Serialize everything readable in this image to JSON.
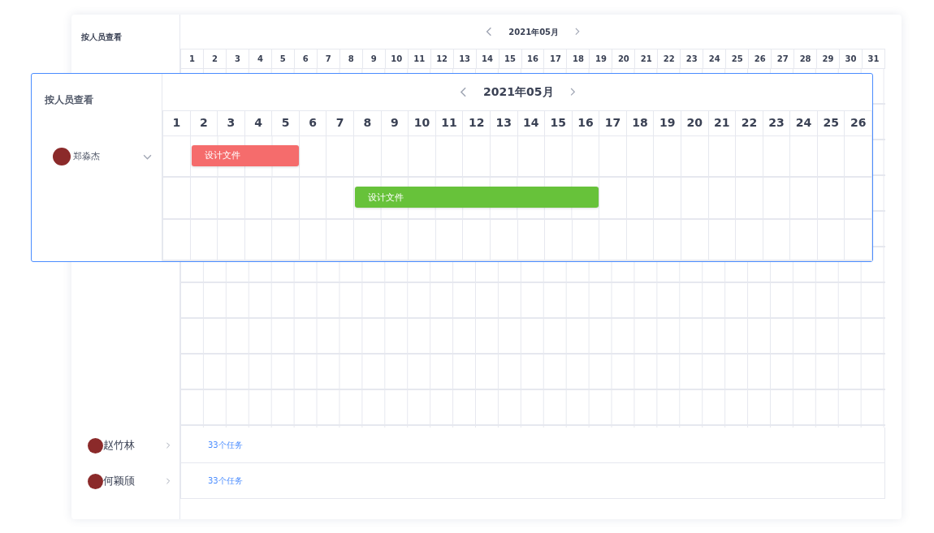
{
  "background_view": {
    "title": "按人员查看",
    "month": "2021年05月",
    "days": [
      "1",
      "2",
      "3",
      "4",
      "5",
      "6",
      "7",
      "8",
      "9",
      "10",
      "11",
      "12",
      "13",
      "14",
      "15",
      "16",
      "17",
      "18",
      "19",
      "20",
      "21",
      "22",
      "23",
      "24",
      "25",
      "26",
      "27",
      "28",
      "29",
      "30",
      "31"
    ],
    "people": [
      {
        "name": "赵竹林",
        "expanded": false,
        "task_count": "33个任务"
      },
      {
        "name": "何颖颀",
        "expanded": false,
        "task_count": "33个任务"
      }
    ]
  },
  "zoomed_view": {
    "title": "按人员查看",
    "month": "2021年05月",
    "days": [
      "1",
      "2",
      "3",
      "4",
      "5",
      "6",
      "7",
      "8",
      "9",
      "10",
      "11",
      "12",
      "13",
      "14",
      "15",
      "16",
      "17",
      "18",
      "19",
      "20",
      "21",
      "22",
      "23",
      "24",
      "25",
      "26"
    ],
    "person": {
      "name": "郑淼杰",
      "expanded": true
    },
    "tasks": [
      {
        "label": "设计文件",
        "color": "#f56c6c",
        "covers_day": [
          false,
          true,
          true,
          true,
          true,
          false,
          false,
          false,
          false,
          false,
          false,
          false,
          false,
          false,
          false,
          false,
          false,
          false,
          false,
          false,
          false,
          false,
          false,
          false,
          false,
          false
        ]
      },
      {
        "label": "设计文件",
        "color": "#67c23a",
        "covers_day": [
          false,
          false,
          false,
          false,
          false,
          false,
          false,
          true,
          true,
          true,
          true,
          true,
          true,
          true,
          true,
          true,
          false,
          false,
          false,
          false,
          false,
          false,
          false,
          false,
          false,
          false
        ]
      }
    ]
  }
}
